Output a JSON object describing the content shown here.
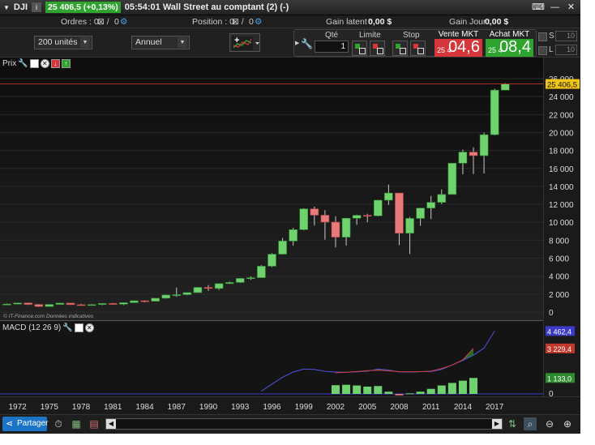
{
  "title_bar": {
    "symbol": "DJI",
    "quote": "25 406,5 (+0,13%)",
    "time_title": "05:54:01 Wall Street au comptant (2) (-)"
  },
  "info_bar": {
    "orders_label": "Ordres : 0",
    "orders_count": "0",
    "position_label": "Position : 0",
    "position_count": "0",
    "gain_latent_label": "Gain latent :",
    "gain_latent_value": "0,00 $",
    "gain_jour_label": "Gain Jour :",
    "gain_jour_value": "0,00 $"
  },
  "controls": {
    "units_select": "200 unités",
    "period_select": "Annuel",
    "qty_label": "Qté",
    "qty_value": "1",
    "limite_label": "Limite",
    "stop_label": "Stop",
    "sell": {
      "label": "Vente MKT",
      "small": "25 4",
      "big": "04,6",
      "color": "#d6353a"
    },
    "buy": {
      "label": "Achat MKT",
      "small": "25 4",
      "big": "08,4",
      "color": "#2ea32e"
    },
    "s_label": "S",
    "s_value": "10",
    "l_label": "L",
    "l_value": "10"
  },
  "price_pane": {
    "label": "Prix",
    "copyright": "© IT-Finance.com  Données indicatives",
    "current_price_label": "25 406,5"
  },
  "macd_pane": {
    "label": "MACD (12 26 9)",
    "axis_values": {
      "blue": "4 462,4",
      "red": "3 229,4",
      "green": "1 133,0"
    }
  },
  "bottom_bar": {
    "share_label": "Partager"
  },
  "chart_data": {
    "type": "candlestick",
    "y_axis_ticks": [
      "26 000",
      "24 000",
      "22 000",
      "20 000",
      "18 000",
      "16 000",
      "14 000",
      "12 000",
      "10 000",
      "8 000",
      "6 000",
      "4 000",
      "2 000",
      "0"
    ],
    "x_axis_ticks": [
      "1972",
      "1975",
      "1978",
      "1981",
      "1984",
      "1987",
      "1990",
      "1993",
      "1996",
      "1999",
      "2002",
      "2005",
      "2008",
      "2011",
      "2014",
      "2017"
    ],
    "ylim": [
      0,
      26000
    ],
    "candles": [
      {
        "year": 1971,
        "o": 840,
        "h": 950,
        "l": 790,
        "c": 890
      },
      {
        "year": 1972,
        "o": 890,
        "h": 1040,
        "l": 880,
        "c": 1020
      },
      {
        "year": 1973,
        "o": 1020,
        "h": 1050,
        "l": 790,
        "c": 850
      },
      {
        "year": 1974,
        "o": 850,
        "h": 890,
        "l": 570,
        "c": 620
      },
      {
        "year": 1975,
        "o": 620,
        "h": 880,
        "l": 600,
        "c": 850
      },
      {
        "year": 1976,
        "o": 850,
        "h": 1015,
        "l": 840,
        "c": 1000
      },
      {
        "year": 1977,
        "o": 1000,
        "h": 1000,
        "l": 800,
        "c": 830
      },
      {
        "year": 1978,
        "o": 830,
        "h": 910,
        "l": 740,
        "c": 805
      },
      {
        "year": 1979,
        "o": 805,
        "h": 900,
        "l": 800,
        "c": 840
      },
      {
        "year": 1980,
        "o": 840,
        "h": 1000,
        "l": 760,
        "c": 960
      },
      {
        "year": 1981,
        "o": 960,
        "h": 1025,
        "l": 820,
        "c": 875
      },
      {
        "year": 1982,
        "o": 875,
        "h": 1070,
        "l": 770,
        "c": 1045
      },
      {
        "year": 1983,
        "o": 1045,
        "h": 1290,
        "l": 1030,
        "c": 1260
      },
      {
        "year": 1984,
        "o": 1260,
        "h": 1290,
        "l": 1080,
        "c": 1210
      },
      {
        "year": 1985,
        "o": 1210,
        "h": 1560,
        "l": 1180,
        "c": 1545
      },
      {
        "year": 1986,
        "o": 1545,
        "h": 1960,
        "l": 1500,
        "c": 1900
      },
      {
        "year": 1987,
        "o": 1900,
        "h": 2720,
        "l": 1700,
        "c": 1940
      },
      {
        "year": 1988,
        "o": 1940,
        "h": 2190,
        "l": 1880,
        "c": 2170
      },
      {
        "year": 1989,
        "o": 2170,
        "h": 2800,
        "l": 2140,
        "c": 2750
      },
      {
        "year": 1990,
        "o": 2750,
        "h": 3000,
        "l": 2360,
        "c": 2630
      },
      {
        "year": 1991,
        "o": 2630,
        "h": 3170,
        "l": 2470,
        "c": 3170
      },
      {
        "year": 1992,
        "o": 3170,
        "h": 3410,
        "l": 3130,
        "c": 3300
      },
      {
        "year": 1993,
        "o": 3300,
        "h": 3800,
        "l": 3240,
        "c": 3750
      },
      {
        "year": 1994,
        "o": 3750,
        "h": 3980,
        "l": 3590,
        "c": 3830
      },
      {
        "year": 1995,
        "o": 3830,
        "h": 5220,
        "l": 3830,
        "c": 5110
      },
      {
        "year": 1996,
        "o": 5110,
        "h": 6560,
        "l": 5000,
        "c": 6450
      },
      {
        "year": 1997,
        "o": 6450,
        "h": 8260,
        "l": 6390,
        "c": 7910
      },
      {
        "year": 1998,
        "o": 7910,
        "h": 9380,
        "l": 7400,
        "c": 9180
      },
      {
        "year": 1999,
        "o": 9180,
        "h": 11570,
        "l": 9100,
        "c": 11500
      },
      {
        "year": 2000,
        "o": 11500,
        "h": 11750,
        "l": 9650,
        "c": 10790
      },
      {
        "year": 2001,
        "o": 10790,
        "h": 11350,
        "l": 8060,
        "c": 10020
      },
      {
        "year": 2002,
        "o": 10020,
        "h": 10670,
        "l": 7200,
        "c": 8340
      },
      {
        "year": 2003,
        "o": 8340,
        "h": 10450,
        "l": 7420,
        "c": 10450
      },
      {
        "year": 2004,
        "o": 10450,
        "h": 10850,
        "l": 9710,
        "c": 10780
      },
      {
        "year": 2005,
        "o": 10780,
        "h": 10950,
        "l": 10000,
        "c": 10720
      },
      {
        "year": 2006,
        "o": 10720,
        "h": 12510,
        "l": 10660,
        "c": 12460
      },
      {
        "year": 2007,
        "o": 12460,
        "h": 14200,
        "l": 11940,
        "c": 13260
      },
      {
        "year": 2008,
        "o": 13260,
        "h": 13280,
        "l": 7450,
        "c": 8780
      },
      {
        "year": 2009,
        "o": 8780,
        "h": 10580,
        "l": 6470,
        "c": 10430
      },
      {
        "year": 2010,
        "o": 10430,
        "h": 11630,
        "l": 9610,
        "c": 11580
      },
      {
        "year": 2011,
        "o": 11580,
        "h": 12930,
        "l": 10360,
        "c": 12220
      },
      {
        "year": 2012,
        "o": 12220,
        "h": 13660,
        "l": 12040,
        "c": 13100
      },
      {
        "year": 2013,
        "o": 13100,
        "h": 16590,
        "l": 13100,
        "c": 16580
      },
      {
        "year": 2014,
        "o": 16580,
        "h": 18100,
        "l": 15340,
        "c": 17820
      },
      {
        "year": 2015,
        "o": 17820,
        "h": 18350,
        "l": 15370,
        "c": 17420
      },
      {
        "year": 2016,
        "o": 17420,
        "h": 19990,
        "l": 15450,
        "c": 19760
      },
      {
        "year": 2017,
        "o": 19760,
        "h": 24880,
        "l": 19680,
        "c": 24720
      },
      {
        "year": 2018,
        "o": 24720,
        "h": 25500,
        "l": 24700,
        "c": 25406.5
      }
    ],
    "last_price": 25406.5,
    "macd": {
      "start_year": 1995,
      "line": [
        200,
        700,
        1180,
        1560,
        1760,
        1740,
        1600,
        1550,
        1540,
        1570,
        1620,
        1760,
        1700,
        1560,
        1550,
        1580,
        1590,
        1740,
        2060,
        2380,
        2750,
        3250,
        4462.4
      ],
      "signal_start_year": 2002,
      "signal": [
        1500,
        1540,
        1590,
        1650,
        1680,
        1640,
        1580,
        1570,
        1580,
        1620,
        1800,
        2050,
        2420,
        3229.4
      ],
      "histogram_start_year": 2002,
      "histogram": [
        620,
        650,
        600,
        520,
        560,
        160,
        -100,
        40,
        160,
        360,
        600,
        780,
        940,
        1133.0
      ],
      "axis_values": [
        4462.4,
        3229.4,
        1133.0,
        0
      ]
    }
  }
}
